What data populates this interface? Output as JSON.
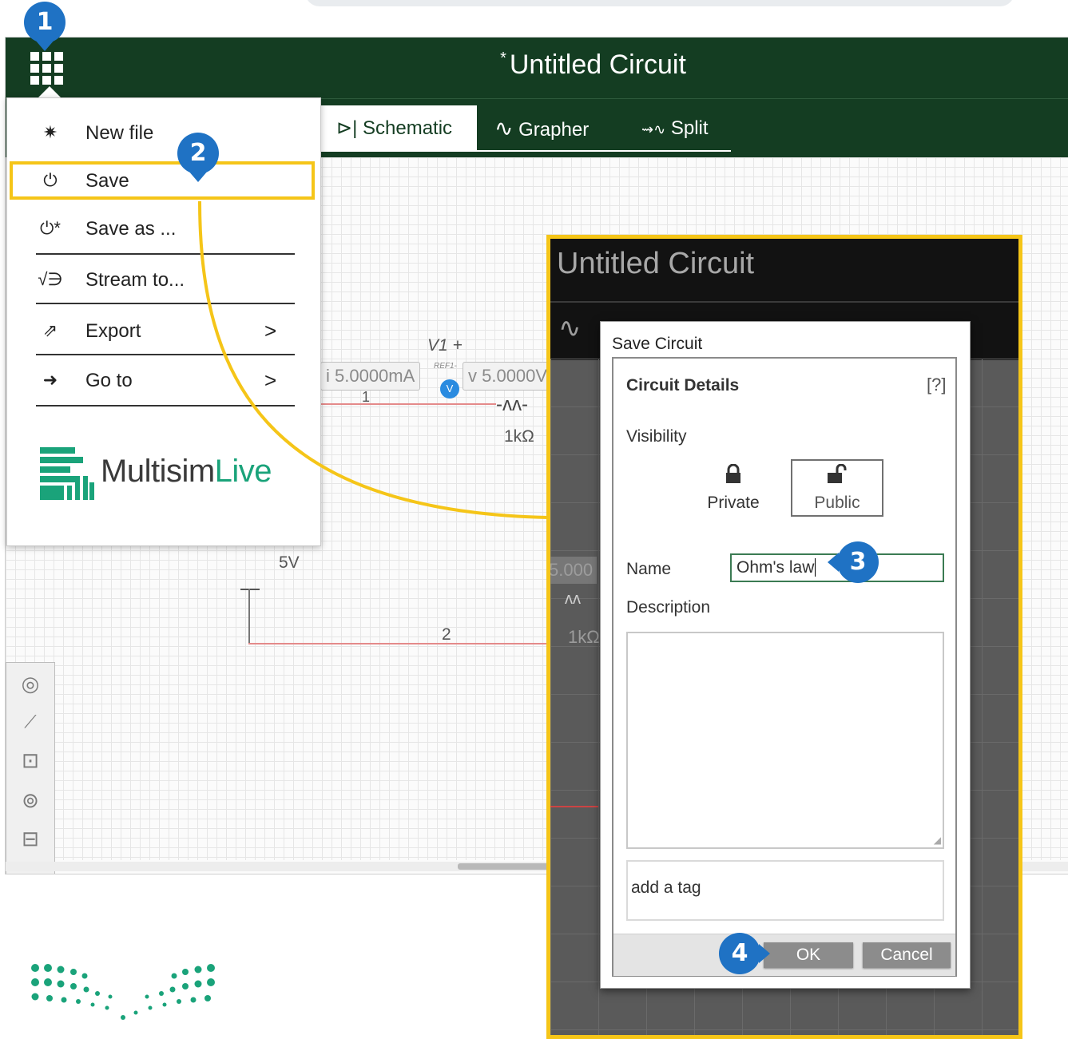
{
  "app": {
    "title_marker": "*",
    "title": "Untitled Circuit",
    "tabs": [
      {
        "label": "Schematic",
        "icon": "diode-icon"
      },
      {
        "label": "Grapher",
        "icon": "sine-wave-icon"
      },
      {
        "label": "Split",
        "icon": "split-view-icon"
      }
    ]
  },
  "menu": {
    "items": [
      {
        "label": "New file",
        "icon": "star-burst-icon"
      },
      {
        "label": "Save",
        "icon": "power-save-icon"
      },
      {
        "label": "Save as ...",
        "icon": "save-as-icon"
      },
      {
        "label": "Stream to...",
        "icon": "stream-icon"
      },
      {
        "label": "Export",
        "icon": "export-icon",
        "arrow": ">"
      },
      {
        "label": "Go to",
        "icon": "arrow-right-icon",
        "arrow": ">"
      }
    ],
    "logo_text_a": "Multisim",
    "logo_text_b": "Live"
  },
  "circuit": {
    "v1_label": "V1 +",
    "ref_label": "REF1-",
    "probe_label": "V",
    "current_readout": "i 5.0000mA",
    "voltage_readout": "v 5.0000V",
    "voltage_readout_partial": "5.000",
    "node_1": "1",
    "node_2": "2",
    "resistor_value": "1kΩ",
    "resistor_value_partial": "1kΩ",
    "source_value": "5V"
  },
  "zoom": {
    "title": "Untitled Circuit"
  },
  "dialog": {
    "title": "Save Circuit",
    "section": "Circuit Details",
    "help": "[?]",
    "visibility_label": "Visibility",
    "private_label": "Private",
    "public_label": "Public",
    "name_label": "Name",
    "name_value": "Ohm's law",
    "description_label": "Description",
    "tag_placeholder": "add a tag",
    "ok_label": "OK",
    "cancel_label": "Cancel"
  },
  "callouts": [
    "1",
    "2",
    "3",
    "4"
  ],
  "colors": {
    "header_bg": "#143d22",
    "highlight": "#f5c518",
    "callout": "#1f72c4",
    "logo_green": "#1aa37a"
  }
}
